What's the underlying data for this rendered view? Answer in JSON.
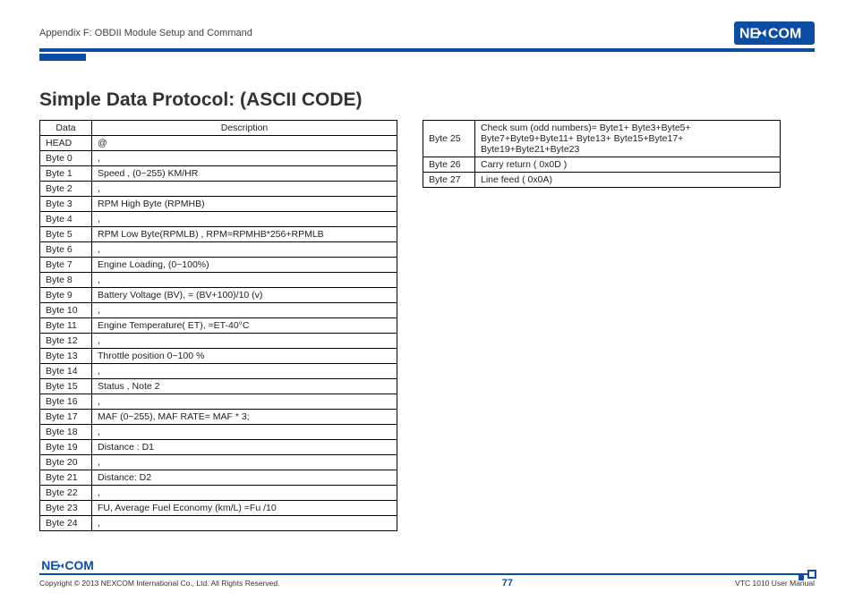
{
  "header": {
    "appendix": "Appendix F: OBDII Module Setup and Command",
    "brand_main": "NE",
    "brand_tail": "COM"
  },
  "heading": "Simple Data Protocol: (ASCII CODE)",
  "table_left": {
    "headers": [
      "Data",
      "Description"
    ],
    "rows": [
      [
        "HEAD",
        "@"
      ],
      [
        "Byte 0",
        ","
      ],
      [
        "Byte 1",
        "Speed , (0~255) KM/HR"
      ],
      [
        "Byte 2",
        ","
      ],
      [
        "Byte 3",
        "RPM High Byte (RPMHB)"
      ],
      [
        "Byte 4",
        ","
      ],
      [
        "Byte 5",
        "RPM Low Byte(RPMLB) , RPM=RPMHB*256+RPMLB"
      ],
      [
        "Byte 6",
        ","
      ],
      [
        "Byte 7",
        "Engine Loading, (0~100%)"
      ],
      [
        "Byte 8",
        ","
      ],
      [
        "Byte 9",
        "Battery Voltage (BV), = (BV+100)/10 (v)"
      ],
      [
        "Byte 10",
        ","
      ],
      [
        "Byte 11",
        "Engine Temperature( ET), =ET-40°C"
      ],
      [
        "Byte 12",
        ","
      ],
      [
        "Byte 13",
        "Throttle position 0~100 %"
      ],
      [
        "Byte 14",
        ","
      ],
      [
        "Byte 15",
        "Status , Note 2"
      ],
      [
        "Byte 16",
        ","
      ],
      [
        "Byte 17",
        "MAF (0~255), MAF RATE= MAF * 3;"
      ],
      [
        "Byte 18",
        ","
      ],
      [
        "Byte 19",
        "Distance : D1"
      ],
      [
        "Byte 20",
        ","
      ],
      [
        "Byte 21",
        "Distance: D2"
      ],
      [
        "Byte 22",
        ","
      ],
      [
        "Byte 23",
        "FU, Average Fuel Economy (km/L) =Fu /10"
      ],
      [
        "Byte 24",
        ","
      ]
    ]
  },
  "table_right": {
    "rows": [
      [
        "Byte 25",
        "Check sum (odd numbers)= Byte1+ Byte3+Byte5+ Byte7+Byte9+Byte11+ Byte13+ Byte15+Byte17+ Byte19+Byte21+Byte23"
      ],
      [
        "Byte 26",
        "Carry return ( 0x0D )"
      ],
      [
        "Byte 27",
        "Line feed ( 0x0A)"
      ]
    ]
  },
  "footer": {
    "copyright": "Copyright © 2013 NEXCOM International Co., Ltd. All Rights Reserved.",
    "page": "77",
    "doc": "VTC 1010 User Manual"
  }
}
